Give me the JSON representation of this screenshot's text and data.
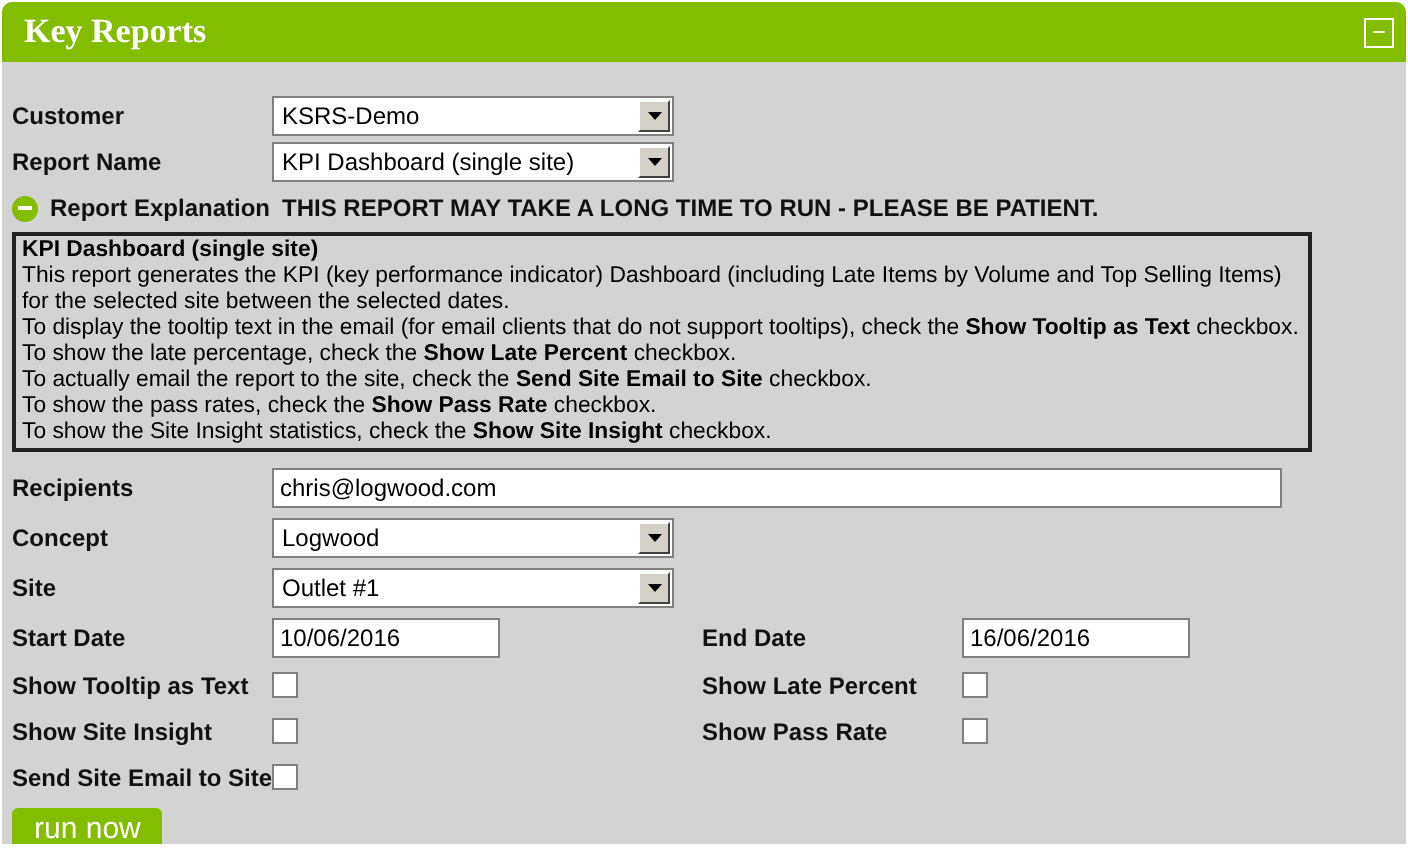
{
  "panel": {
    "title": "Key Reports",
    "collapse_symbol": "−"
  },
  "fields": [
    {
      "kind": "select",
      "label": "Customer",
      "value": "KSRS-Demo"
    },
    {
      "kind": "select",
      "label": "Report Name",
      "value": "KPI Dashboard (single site)"
    }
  ],
  "explanation": {
    "label": "Report Explanation",
    "expanded": true,
    "warning": "THIS REPORT MAY TAKE A LONG TIME TO RUN - PLEASE BE PATIENT.",
    "heading": "KPI Dashboard (single site)",
    "lines": [
      "This report generates the KPI (key performance indicator) Dashboard (including Late Items by Volume and Top Selling Items)",
      "for the selected site between the selected dates.",
      "To display the tooltip text in the email (for email clients that do not support tooltips), check the **Show Tooltip as Text** checkbox.",
      "To show the late percentage, check the **Show Late Percent** checkbox.",
      "To actually email the report to the site, check the **Send Site Email to Site** checkbox.",
      "To show the pass rates, check the **Show Pass Rate** checkbox.",
      "To show the Site Insight statistics, check the **Show Site Insight** checkbox."
    ]
  },
  "fields2": [
    {
      "kind": "input",
      "label": "Recipients",
      "value": "chris@logwood.com"
    },
    {
      "kind": "select",
      "label": "Concept",
      "value": "Logwood"
    },
    {
      "kind": "select",
      "label": "Site",
      "value": "Outlet #1"
    }
  ],
  "dates": [
    {
      "label": "Start Date",
      "value": "10/06/2016"
    },
    {
      "label": "End Date",
      "value": "16/06/2016"
    }
  ],
  "checkboxes": [
    [
      {
        "label": "Show Tooltip as Text",
        "checked": false
      },
      {
        "label": "Show Late Percent",
        "checked": false
      }
    ],
    [
      {
        "label": "Show Site Insight",
        "checked": false
      },
      {
        "label": "Show Pass Rate",
        "checked": false
      }
    ],
    [
      {
        "label": "Send Site Email to Site",
        "checked": false
      }
    ]
  ],
  "run_button": "run now"
}
